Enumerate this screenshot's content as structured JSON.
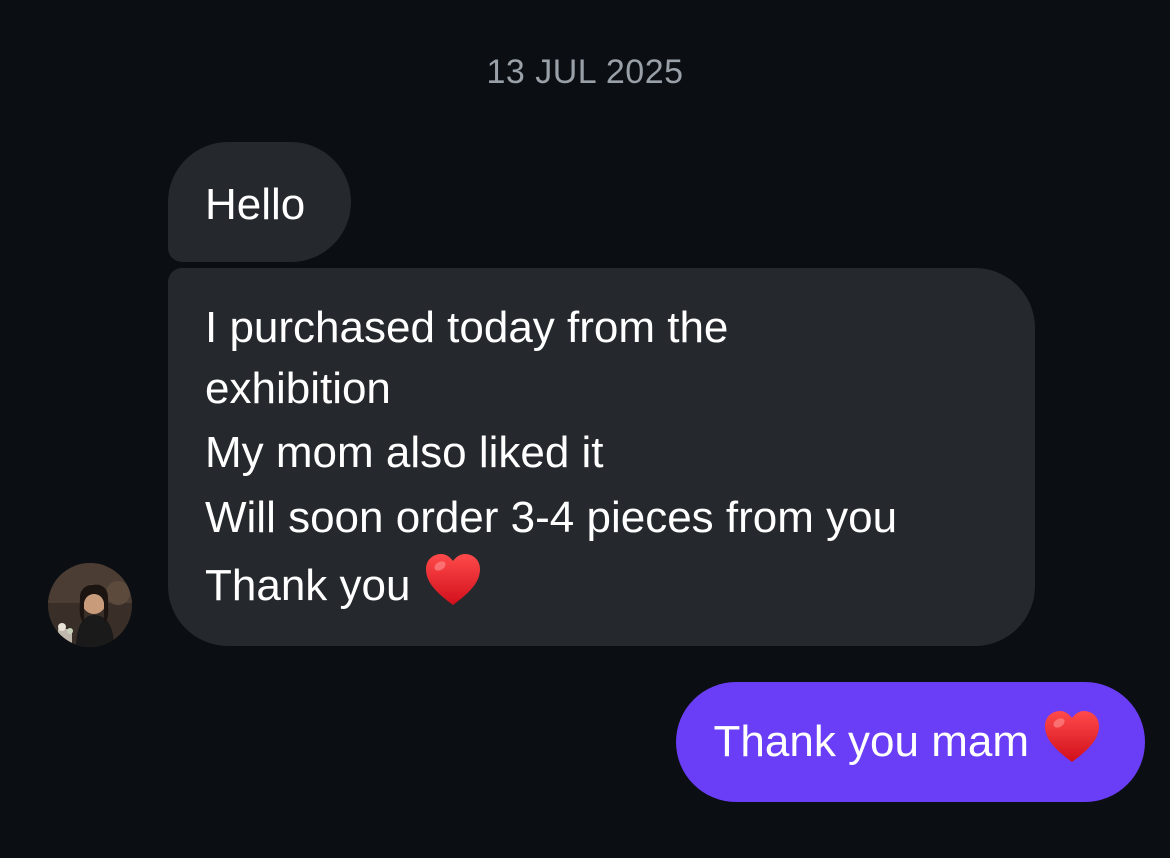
{
  "chat": {
    "date_label": "13 JUL 2025",
    "incoming": {
      "greeting": "Hello",
      "lines": [
        "I purchased today from the",
        "exhibition",
        "My mom also liked it",
        "Will soon order 3-4 pieces from you",
        "Thank you"
      ],
      "emoji": "heart-emoji"
    },
    "outgoing": {
      "text": "Thank you mam",
      "emoji": "heart-emoji",
      "color": "#6a3df6"
    },
    "incoming_color": "#25292e",
    "background_color": "#0b0f13"
  },
  "sender": {
    "avatar_icon": "profile-photo-avatar"
  }
}
